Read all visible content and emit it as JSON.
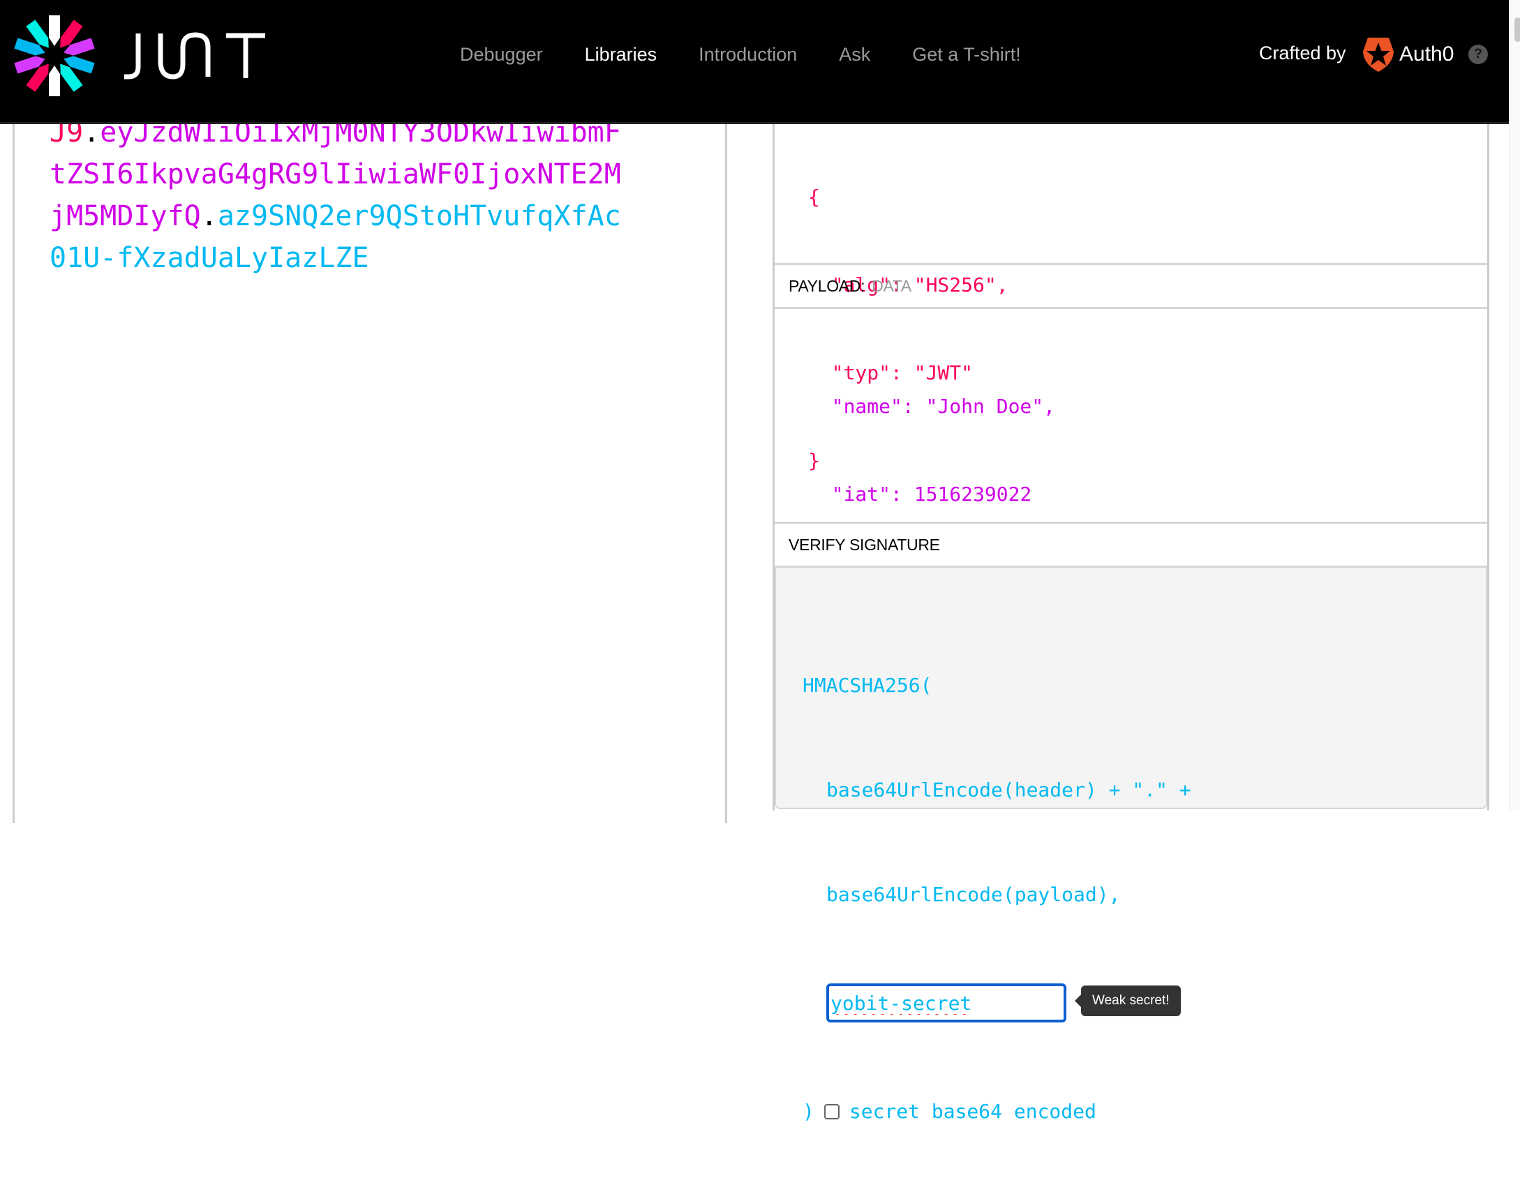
{
  "header": {
    "brand": "JWT",
    "nav": [
      {
        "label": "Debugger",
        "active": false
      },
      {
        "label": "Libraries",
        "active": true
      },
      {
        "label": "Introduction",
        "active": false
      },
      {
        "label": "Ask",
        "active": false
      },
      {
        "label": "Get a T-shirt!",
        "active": false
      }
    ],
    "crafted_by": "Crafted by",
    "partner": "Auth0",
    "help_icon": "?"
  },
  "encoded": {
    "lines": [
      [
        {
          "t": "J9",
          "part": "header"
        },
        {
          "t": ".",
          "part": "dot"
        },
        {
          "t": "eyJzdWIiOiIxMjM0NTY3ODkwIiwibmF",
          "part": "payload"
        }
      ],
      [
        {
          "t": "tZSI6IkpvaG4gRG9lIiwiaWF0IjoxNTE2M",
          "part": "payload"
        }
      ],
      [
        {
          "t": "jM5MDIyfQ",
          "part": "payload"
        },
        {
          "t": ".",
          "part": "dot"
        },
        {
          "t": "az9SNQ2er9QStoHTvufqXfAc",
          "part": "signature"
        }
      ],
      [
        {
          "t": "01U-fXzadUaLyIazLZE",
          "part": "signature"
        }
      ]
    ]
  },
  "decoded": {
    "header_json": [
      "{",
      "  \"alg\": \"HS256\",",
      "  \"typ\": \"JWT\"",
      "}"
    ],
    "payload": {
      "title": "PAYLOAD:",
      "subtitle": "DATA",
      "json": [
        "  \"name\": \"John Doe\",",
        "  \"iat\": 1516239022",
        "}"
      ]
    },
    "verify": {
      "title": "VERIFY SIGNATURE",
      "fn_open": "HMACSHA256(",
      "arg1": "base64UrlEncode(header) + \".\" +",
      "arg2": "base64UrlEncode(payload),",
      "secret_value": "yobit-secret",
      "tooltip": "Weak secret!",
      "fn_close": ")",
      "checkbox_label": "secret base64 encoded",
      "checkbox_checked": false
    }
  },
  "colors": {
    "header": "#fb015b",
    "payload": "#d63aff",
    "signature": "#00b9f1",
    "input_focus": "#0b5fd1"
  }
}
